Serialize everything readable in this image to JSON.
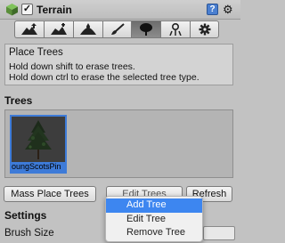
{
  "header": {
    "title": "Terrain",
    "enabled": true,
    "check_glyph": "✓",
    "help_label": "?",
    "settings_glyph": "⚙"
  },
  "toolbar": {
    "tools": [
      {
        "name": "raise-lower-tool",
        "icon": "mountain-arrow-icon"
      },
      {
        "name": "paint-height-tool",
        "icon": "mountain-plateau-icon"
      },
      {
        "name": "smooth-height-tool",
        "icon": "mountain-drop-icon"
      },
      {
        "name": "paint-texture-tool",
        "icon": "brush-icon"
      },
      {
        "name": "place-trees-tool",
        "icon": "tree-icon",
        "active": true
      },
      {
        "name": "paint-details-tool",
        "icon": "flower-grass-icon"
      },
      {
        "name": "terrain-settings-tool",
        "icon": "gear-icon"
      }
    ]
  },
  "info": {
    "title": "Place Trees",
    "line1": "Hold down shift to erase trees.",
    "line2": "Hold down ctrl to erase the selected tree type."
  },
  "trees": {
    "section_label": "Trees",
    "items": [
      {
        "name": "YoungScotsPine",
        "selected": true,
        "visible_label": "oungScotsPin"
      }
    ]
  },
  "buttons": {
    "mass_place": "Mass Place Trees",
    "edit_trees": "Edit Trees",
    "refresh": "Refresh"
  },
  "settings": {
    "section_label": "Settings",
    "brush_size_label": "Brush Size"
  },
  "menu": {
    "items": [
      "Add Tree",
      "Edit Tree",
      "Remove Tree"
    ],
    "highlighted": "Add Tree"
  },
  "colors": {
    "accent": "#3d86f0",
    "selection": "#3e7bd8",
    "panel": "#c2c2c2"
  }
}
